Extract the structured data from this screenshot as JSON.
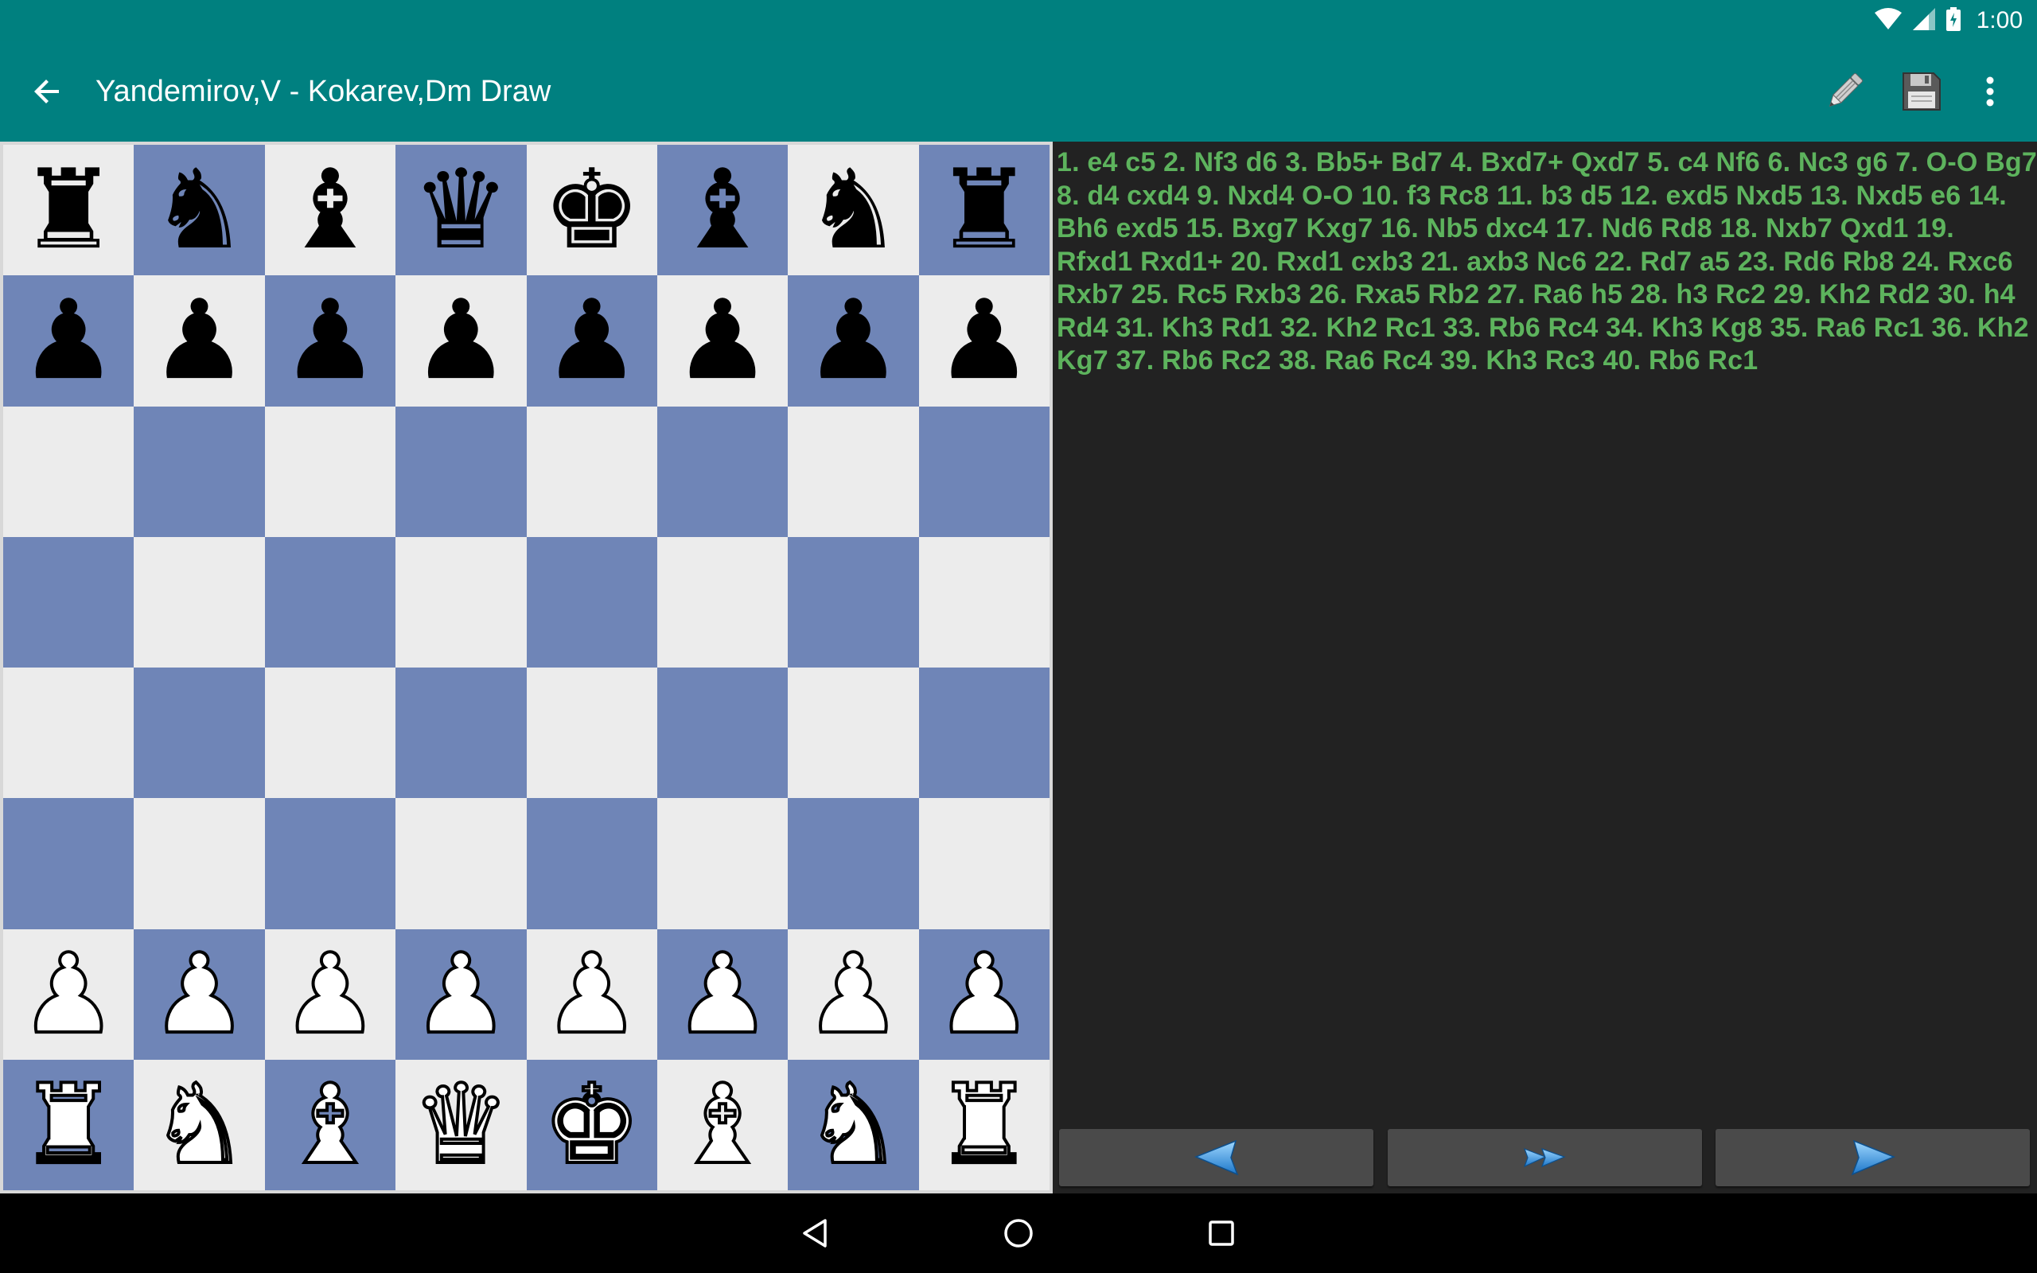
{
  "status_bar": {
    "time": "1:00",
    "icons": [
      "wifi-icon",
      "signal-icon",
      "battery-charging-icon"
    ]
  },
  "app_bar": {
    "title": "Yandemirov,V - Kokarev,Dm Draw",
    "back_icon": "arrow-left-icon",
    "actions": [
      "pencil-icon",
      "floppy-disk-icon",
      "more-vert-icon"
    ]
  },
  "board": {
    "colors": {
      "light": "#ececec",
      "dark": "#6f85b7"
    },
    "position": [
      [
        "br",
        "bn",
        "bb",
        "bq",
        "bk",
        "bb",
        "bn",
        "br"
      ],
      [
        "bp",
        "bp",
        "bp",
        "bp",
        "bp",
        "bp",
        "bp",
        "bp"
      ],
      [
        "",
        "",
        "",
        "",
        "",
        "",
        "",
        ""
      ],
      [
        "",
        "",
        "",
        "",
        "",
        "",
        "",
        ""
      ],
      [
        "",
        "",
        "",
        "",
        "",
        "",
        "",
        ""
      ],
      [
        "",
        "",
        "",
        "",
        "",
        "",
        "",
        ""
      ],
      [
        "wp",
        "wp",
        "wp",
        "wp",
        "wp",
        "wp",
        "wp",
        "wp"
      ],
      [
        "wr",
        "wn",
        "wb",
        "wq",
        "wk",
        "wb",
        "wn",
        "wr"
      ]
    ]
  },
  "moves": {
    "text": "1. e4 c5 2. Nf3 d6 3. Bb5+ Bd7 4. Bxd7+ Qxd7 5. c4 Nf6 6. Nc3 g6 7. O-O Bg7 8. d4 cxd4 9. Nxd4 O-O 10. f3 Rc8 11. b3 d5 12. exd5 Nxd5 13. Nxd5 e6 14. Bh6 exd5 15. Bxg7 Kxg7 16. Nb5 dxc4 17. Nd6 Rd8 18. Nxb7 Qxd1 19. Rfxd1 Rxd1+ 20. Rxd1 cxb3 21. axb3 Nc6 22. Rd7 a5 23. Rd6 Rb8 24. Rxc6 Rxb7 25. Rc5 Rxb3 26. Rxa5 Rb2 27. Ra6 h5 28. h3 Rc2 29. Kh2 Rd2 30. h4 Rd4 31. Kh3 Rd1 32. Kh2 Rc1 33. Rb6 Rc4 34. Kh3 Kg8 35. Ra6 Rc1 36. Kh2 Kg7 37. Rb6 Rc2 38. Ra6 Rc4 39. Kh3 Rc3 40. Rb6 Rc1",
    "color": "#5db35d"
  },
  "nav_buttons": [
    "triangle-left-icon",
    "fast-forward-icon",
    "triangle-right-icon"
  ],
  "system_nav": [
    "back-triangle-icon",
    "home-circle-icon",
    "recents-square-icon"
  ]
}
